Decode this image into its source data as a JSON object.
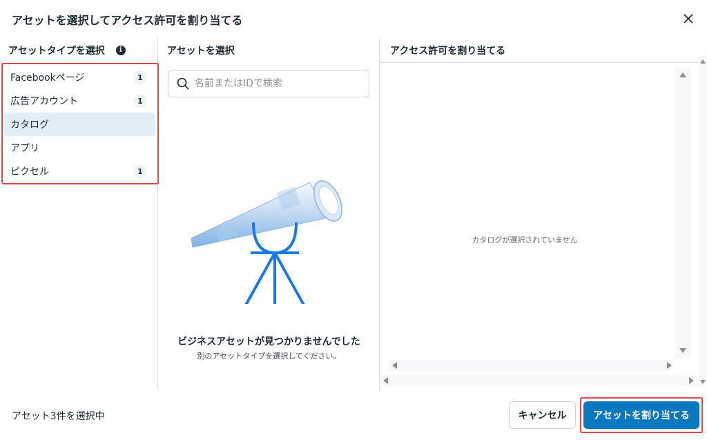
{
  "dialog": {
    "title": "アセットを選択してアクセス許可を割り当てる",
    "close_icon": "close-icon"
  },
  "asset_types": {
    "header": "アセットタイプを選択",
    "info_icon": "info-icon",
    "info_glyph": "i",
    "items": [
      {
        "label": "Facebookページ",
        "count": "1",
        "selected": false
      },
      {
        "label": "広告アカウント",
        "count": "1",
        "selected": false
      },
      {
        "label": "カタログ",
        "count": "",
        "selected": true
      },
      {
        "label": "アプリ",
        "count": "",
        "selected": false
      },
      {
        "label": "ピクセル",
        "count": "1",
        "selected": false
      }
    ]
  },
  "asset_select": {
    "header": "アセットを選択",
    "search_placeholder": "名前またはIDで検索",
    "search_icon": "search-icon",
    "illustration": "telescope-illustration",
    "empty_title": "ビジネスアセットが見つかりませんでした",
    "empty_subtitle": "別のアセットタイプを選択してください。"
  },
  "permissions": {
    "header": "アクセス許可を割り当てる",
    "empty_text": "カタログが選択されていません"
  },
  "footer": {
    "status": "アセット3件を選択中",
    "cancel_label": "キャンセル",
    "assign_label": "アセットを割り当てる"
  },
  "colors": {
    "primary": "#0a78be",
    "highlight_outline": "#e0474c",
    "selected_bg": "#e1edf7",
    "telescope_blue": "#1877f2"
  }
}
